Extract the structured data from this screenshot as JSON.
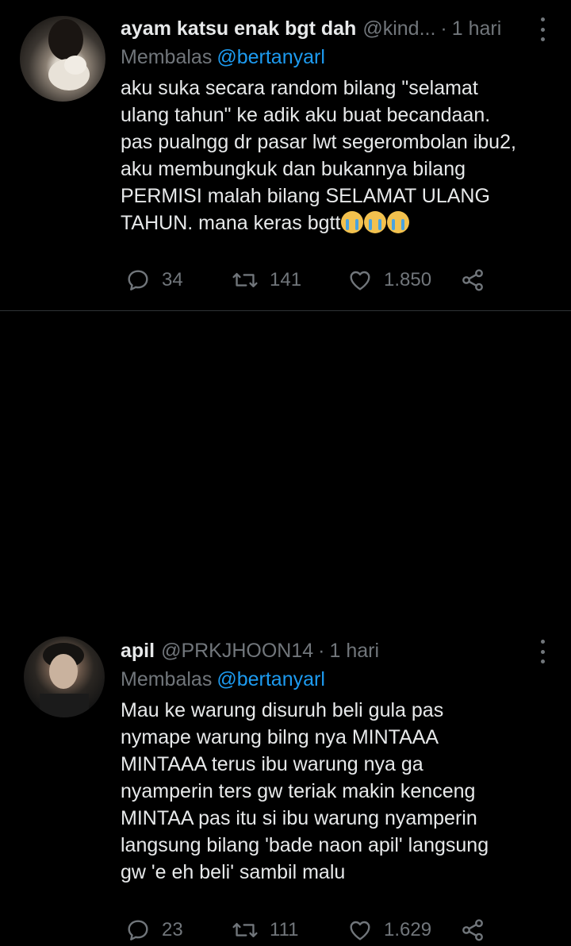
{
  "tweets": [
    {
      "name": "ayam katsu enak bgt dah",
      "handle": "@kind...",
      "time": "1 hari",
      "reply_prefix": "Membalas",
      "reply_to": "@bertanyarl",
      "text": "aku suka secara random bilang \"selamat\nulang tahun\" ke adik aku buat becandaan.\npas pualngg dr pasar lwt segerombolan ibu2,\naku membungkuk dan bukannya bilang\nPERMISI malah bilang SELAMAT ULANG\nTAHUN. mana keras bgtt",
      "emoji": "😭😭😭",
      "counts": {
        "replies": "34",
        "retweets": "141",
        "likes": "1.850"
      }
    },
    {
      "name": "apil",
      "handle": "@PRKJHOON14",
      "time": "1 hari",
      "reply_prefix": "Membalas",
      "reply_to": "@bertanyarl",
      "text": "Mau ke warung disuruh beli gula pas\nnymape warung bilng nya MINTAAA\nMINTAAA terus ibu warung nya ga\nnyamperin ters gw teriak makin kenceng\nMINTAA pas itu si ibu warung nyamperin\nlangsung bilang 'bade naon apil' langsung\ngw 'e eh beli' sambil malu",
      "counts": {
        "replies": "23",
        "retweets": "111",
        "likes": "1.629"
      }
    }
  ],
  "separator": "·",
  "icons": [
    "reply-icon",
    "retweet-icon",
    "like-icon",
    "share-icon",
    "more-icon"
  ],
  "colors": {
    "background": "#000000",
    "text": "#e7e9ea",
    "muted": "#71767b",
    "link": "#1d9bf0"
  }
}
